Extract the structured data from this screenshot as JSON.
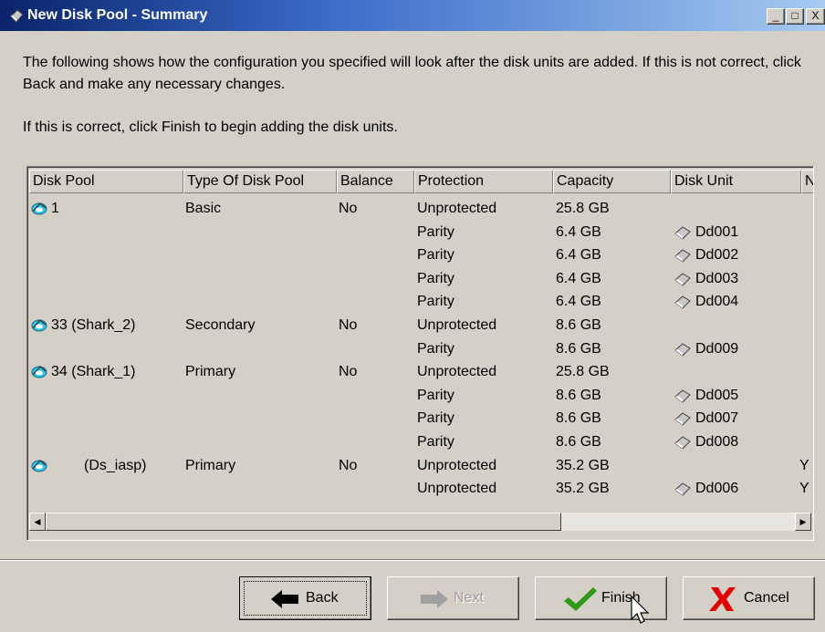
{
  "window": {
    "title": "New Disk Pool - Summary",
    "controls": {
      "minimize": "_",
      "maximize": "□",
      "close": "X"
    }
  },
  "intro": {
    "line1": "The following shows how the configuration you specified will look after the disk units are added.  If this is not correct, click Back and make any necessary changes.",
    "line2": "If this is correct, click Finish to begin adding the disk units."
  },
  "table": {
    "columns": [
      "Disk Pool",
      "Type Of Disk Pool",
      "Balance",
      "Protection",
      "Capacity",
      "Disk Unit",
      "N"
    ],
    "rows": [
      {
        "pool": "1",
        "type": "Basic",
        "balance": "No",
        "protection": "Unprotected",
        "capacity": "25.8 GB",
        "unit": "",
        "extra": ""
      },
      {
        "pool": "",
        "type": "",
        "balance": "",
        "protection": "Parity",
        "capacity": "6.4 GB",
        "unit": "Dd001",
        "extra": ""
      },
      {
        "pool": "",
        "type": "",
        "balance": "",
        "protection": "Parity",
        "capacity": "6.4 GB",
        "unit": "Dd002",
        "extra": ""
      },
      {
        "pool": "",
        "type": "",
        "balance": "",
        "protection": "Parity",
        "capacity": "6.4 GB",
        "unit": "Dd003",
        "extra": ""
      },
      {
        "pool": "",
        "type": "",
        "balance": "",
        "protection": "Parity",
        "capacity": "6.4 GB",
        "unit": "Dd004",
        "extra": ""
      },
      {
        "pool": "33 (Shark_2)",
        "type": "Secondary",
        "balance": "No",
        "protection": "Unprotected",
        "capacity": "8.6 GB",
        "unit": "",
        "extra": ""
      },
      {
        "pool": "",
        "type": "",
        "balance": "",
        "protection": "Parity",
        "capacity": "8.6 GB",
        "unit": "Dd009",
        "extra": ""
      },
      {
        "pool": "34 (Shark_1)",
        "type": "Primary",
        "balance": "No",
        "protection": "Unprotected",
        "capacity": "25.8 GB",
        "unit": "",
        "extra": ""
      },
      {
        "pool": "",
        "type": "",
        "balance": "",
        "protection": "Parity",
        "capacity": "8.6 GB",
        "unit": "Dd005",
        "extra": ""
      },
      {
        "pool": "",
        "type": "",
        "balance": "",
        "protection": "Parity",
        "capacity": "8.6 GB",
        "unit": "Dd007",
        "extra": ""
      },
      {
        "pool": "",
        "type": "",
        "balance": "",
        "protection": "Parity",
        "capacity": "8.6 GB",
        "unit": "Dd008",
        "extra": ""
      },
      {
        "pool": "(Ds_iasp)",
        "type": "Primary",
        "balance": "No",
        "protection": "Unprotected",
        "capacity": "35.2 GB",
        "unit": "",
        "extra": "Y"
      },
      {
        "pool": "",
        "type": "",
        "balance": "",
        "protection": "Unprotected",
        "capacity": "35.2 GB",
        "unit": "Dd006",
        "extra": "Y"
      }
    ]
  },
  "scrollbar": {
    "left_arrow": "◀",
    "right_arrow": "▶"
  },
  "buttons": {
    "back": "Back",
    "next": "Next",
    "finish": "Finish",
    "cancel": "Cancel"
  },
  "colors": {
    "titlebar_start": "#0a246a",
    "titlebar_end": "#a6caf0",
    "face": "#d4d0c8",
    "pool_icon": "#29c5e6",
    "finish_check": "#2f9a1a",
    "cancel_x": "#e00000"
  }
}
